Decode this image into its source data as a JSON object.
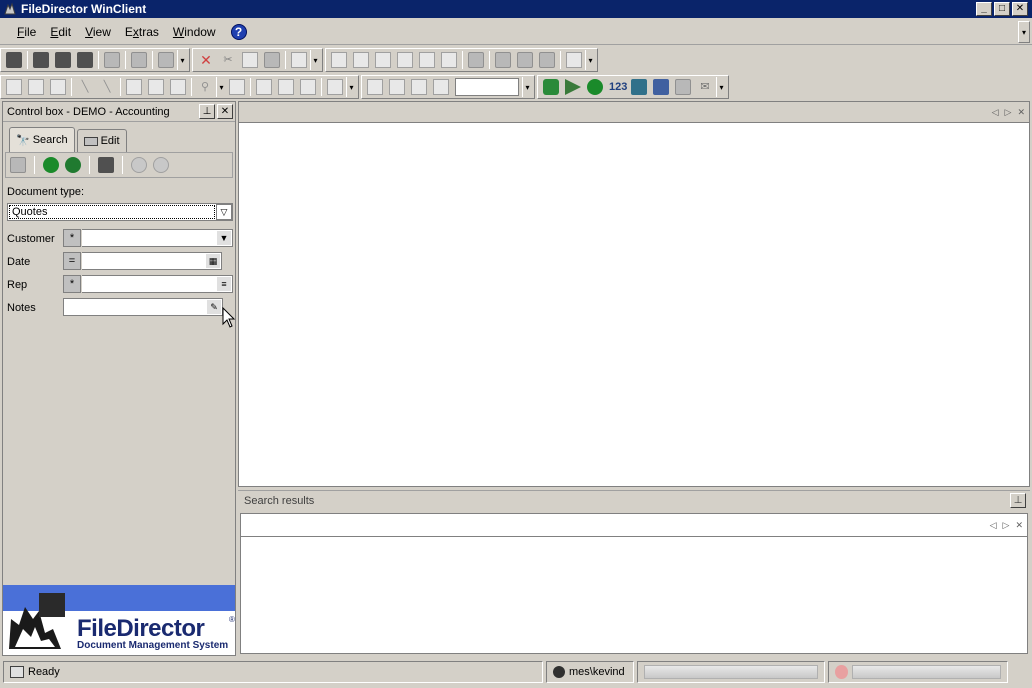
{
  "window": {
    "title": "FileDirector WinClient"
  },
  "menu": [
    {
      "label": "File",
      "key": "F",
      "rest": "ile"
    },
    {
      "label": "Edit",
      "key": "E",
      "rest": "dit"
    },
    {
      "label": "View",
      "key": "V",
      "rest": "iew"
    },
    {
      "label": "Extras",
      "key": "x",
      "pre": "E",
      "rest": "tras"
    },
    {
      "label": "Window",
      "key": "W",
      "rest": "indow"
    }
  ],
  "control_box": {
    "title": "Control box - DEMO - Accounting",
    "tabs": [
      {
        "label": "Search",
        "active": true
      },
      {
        "label": "Edit",
        "active": false
      }
    ],
    "document_type_label": "Document type:",
    "document_type_value": "Quotes",
    "fields": [
      {
        "label": "Customer",
        "operator": "*",
        "value": "",
        "button": "dropdown"
      },
      {
        "label": "Date",
        "operator": "=",
        "value": "",
        "button": "calendar"
      },
      {
        "label": "Rep",
        "operator": "*",
        "value": "",
        "button": "list"
      },
      {
        "label": "Notes",
        "operator": "",
        "value": "",
        "button": "edit"
      }
    ]
  },
  "logo": {
    "title": "FileDirector",
    "reg": "®",
    "subtitle": "Document Management System"
  },
  "search_results": {
    "title": "Search results"
  },
  "status": {
    "text": "Ready",
    "user": "mes\\kevind"
  },
  "colors": {
    "titlebar": "#0a246a",
    "logo_bar": "#4a70d8",
    "logo_text": "#1a2a70"
  }
}
